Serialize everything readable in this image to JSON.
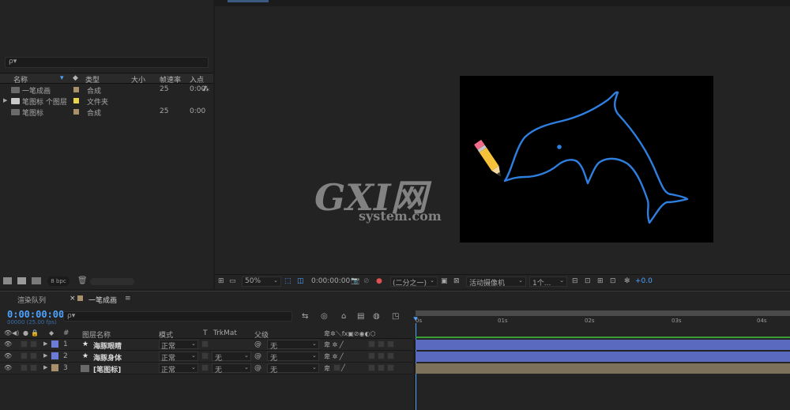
{
  "project": {
    "search_placeholder": "ρ▾",
    "columns": {
      "name": "名称",
      "type": "类型",
      "size": "大小",
      "fps": "帧速率",
      "in": "入点"
    },
    "items": [
      {
        "name": "一笔成画",
        "type": "合成",
        "fps": "25",
        "in": "0:00",
        "label_color": "#a7906a"
      },
      {
        "name": "笔图标 个图层",
        "type": "文件夹",
        "fps": "",
        "in": "",
        "label_color": "#e8d44d"
      },
      {
        "name": "笔图标",
        "type": "合成",
        "fps": "25",
        "in": "0:00",
        "label_color": "#a7906a"
      }
    ],
    "bpc": "8 bpc"
  },
  "viewer": {
    "zoom": "50%",
    "timecode": "0:00:00:00",
    "resolution": "(二分之一)",
    "camera": "活动摄像机",
    "views": "1个...",
    "exposure": "+0.0",
    "watermark_big": "GXI网",
    "watermark_small": "system.com"
  },
  "timeline": {
    "tabs": [
      "渲染队列",
      "一笔成画"
    ],
    "timecode": "0:00:00:00",
    "timecode_sub": "00000 (25.00 fps)",
    "columns": {
      "num": "#",
      "name": "图层名称",
      "mode": "模式",
      "t": "T",
      "trkmat": "TrkMat",
      "parent": "父级"
    },
    "layers": [
      {
        "num": "1",
        "name": "海豚眼睛",
        "mode": "正常",
        "trkmat": "",
        "parent": "无",
        "color": "#6c7bd8",
        "bar": "#5a6bbf"
      },
      {
        "num": "2",
        "name": "海豚身体",
        "mode": "正常",
        "trkmat": "无",
        "parent": "无",
        "color": "#6c7bd8",
        "bar": "#5a6bbf"
      },
      {
        "num": "3",
        "name": "[笔图标]",
        "mode": "正常",
        "trkmat": "无",
        "parent": "无",
        "color": "#a7906a",
        "bar": "#7e715c"
      }
    ],
    "ruler": [
      "0s",
      "01s",
      "02s",
      "03s",
      "04s"
    ]
  },
  "colors": {
    "accent": "#4ea3ff",
    "dolphin": "#2f7fe0",
    "pencil": "#f5c23a"
  }
}
